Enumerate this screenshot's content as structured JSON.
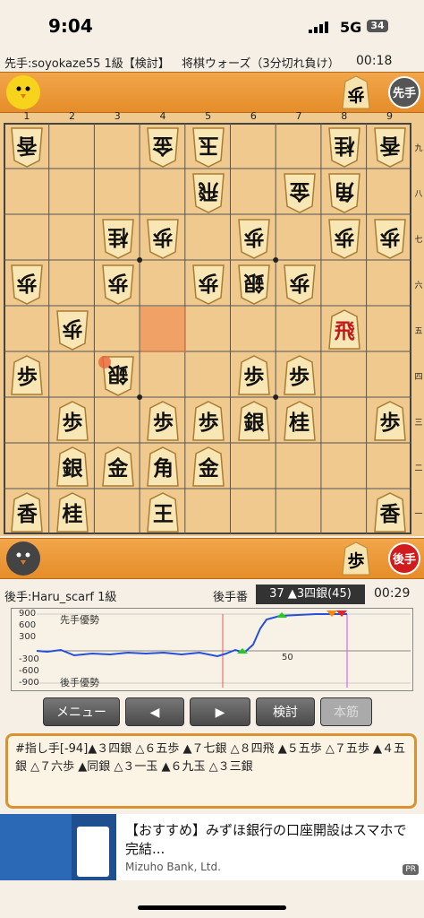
{
  "status_bar": {
    "time": "9:04",
    "network": "5G",
    "battery": "34"
  },
  "game_header": {
    "sente_player": "先手:soyokaze55 1級【検討】",
    "game_type": "将棋ウォーズ（3分切れ負け）",
    "sente_time": "00:18"
  },
  "sente_bar": {
    "badge": "先手",
    "hand": [
      "歩"
    ]
  },
  "board": {
    "col_labels": [
      "1",
      "2",
      "3",
      "4",
      "5",
      "6",
      "7",
      "8",
      "9"
    ],
    "row_labels": [
      "九",
      "八",
      "七",
      "六",
      "五",
      "四",
      "三",
      "二",
      "一"
    ],
    "pieces": [
      {
        "c": 0,
        "r": 0,
        "k": "香",
        "g": true
      },
      {
        "c": 3,
        "r": 0,
        "k": "金",
        "g": true
      },
      {
        "c": 4,
        "r": 0,
        "k": "玉",
        "g": true
      },
      {
        "c": 7,
        "r": 0,
        "k": "桂",
        "g": true
      },
      {
        "c": 8,
        "r": 0,
        "k": "香",
        "g": true
      },
      {
        "c": 4,
        "r": 1,
        "k": "飛",
        "g": true
      },
      {
        "c": 6,
        "r": 1,
        "k": "金",
        "g": true
      },
      {
        "c": 7,
        "r": 1,
        "k": "角",
        "g": true
      },
      {
        "c": 2,
        "r": 2,
        "k": "桂",
        "g": true
      },
      {
        "c": 3,
        "r": 2,
        "k": "歩",
        "g": true
      },
      {
        "c": 5,
        "r": 2,
        "k": "歩",
        "g": true
      },
      {
        "c": 7,
        "r": 2,
        "k": "歩",
        "g": true
      },
      {
        "c": 8,
        "r": 2,
        "k": "歩",
        "g": true
      },
      {
        "c": 0,
        "r": 3,
        "k": "歩",
        "g": true
      },
      {
        "c": 2,
        "r": 3,
        "k": "歩",
        "g": true
      },
      {
        "c": 4,
        "r": 3,
        "k": "歩",
        "g": true
      },
      {
        "c": 5,
        "r": 3,
        "k": "銀",
        "g": true
      },
      {
        "c": 6,
        "r": 3,
        "k": "歩",
        "g": true
      },
      {
        "c": 1,
        "r": 4,
        "k": "歩",
        "g": true
      },
      {
        "c": 7,
        "r": 4,
        "k": "飛",
        "g": false,
        "p": true
      },
      {
        "c": 0,
        "r": 5,
        "k": "歩",
        "g": false
      },
      {
        "c": 2,
        "r": 5,
        "k": "銀",
        "g": true
      },
      {
        "c": 5,
        "r": 5,
        "k": "歩",
        "g": false
      },
      {
        "c": 6,
        "r": 5,
        "k": "歩",
        "g": false
      },
      {
        "c": 1,
        "r": 6,
        "k": "歩",
        "g": false
      },
      {
        "c": 3,
        "r": 6,
        "k": "歩",
        "g": false
      },
      {
        "c": 4,
        "r": 6,
        "k": "歩",
        "g": false
      },
      {
        "c": 5,
        "r": 6,
        "k": "銀",
        "g": false
      },
      {
        "c": 6,
        "r": 6,
        "k": "桂",
        "g": false
      },
      {
        "c": 8,
        "r": 6,
        "k": "歩",
        "g": false
      },
      {
        "c": 1,
        "r": 7,
        "k": "銀",
        "g": false
      },
      {
        "c": 2,
        "r": 7,
        "k": "金",
        "g": false
      },
      {
        "c": 3,
        "r": 7,
        "k": "角",
        "g": false
      },
      {
        "c": 4,
        "r": 7,
        "k": "金",
        "g": false
      },
      {
        "c": 0,
        "r": 8,
        "k": "香",
        "g": false
      },
      {
        "c": 1,
        "r": 8,
        "k": "桂",
        "g": false
      },
      {
        "c": 3,
        "r": 8,
        "k": "王",
        "g": false
      },
      {
        "c": 8,
        "r": 8,
        "k": "香",
        "g": false
      }
    ],
    "highlight_square": {
      "c": 3,
      "r": 4
    },
    "last_move_marker": {
      "c": 2,
      "r": 5
    }
  },
  "gote_bar": {
    "badge": "後手",
    "hand": [
      "歩"
    ]
  },
  "info": {
    "gote_player": "後手:Haru_scarf 1級",
    "turn_label": "後手番",
    "move_info": "37 ▲3四銀(45)",
    "gote_time": "00:29"
  },
  "eval_graph": {
    "ticks": [
      "900",
      "600",
      "300",
      "-300",
      "-600",
      "-900"
    ],
    "sente_label": "先手優勢",
    "gote_label": "後手優勢",
    "mid_label": "50"
  },
  "buttons": {
    "menu": "メニュー",
    "prev": "◀",
    "next": "▶",
    "analyze": "検討",
    "main_line": "本筋"
  },
  "moves_text": "#指し手[-94]▲３四銀 △６五歩 ▲７七銀 △８四飛 ▲５五歩 △７五歩 ▲４五銀 △７六歩 ▲同銀 △３一玉 ▲６九玉 △３三銀",
  "ad": {
    "title": "【おすすめ】みずほ銀行の口座開設はスマホで完結...",
    "advertiser": "Mizuho Bank, Ltd.",
    "pr": "PR"
  }
}
